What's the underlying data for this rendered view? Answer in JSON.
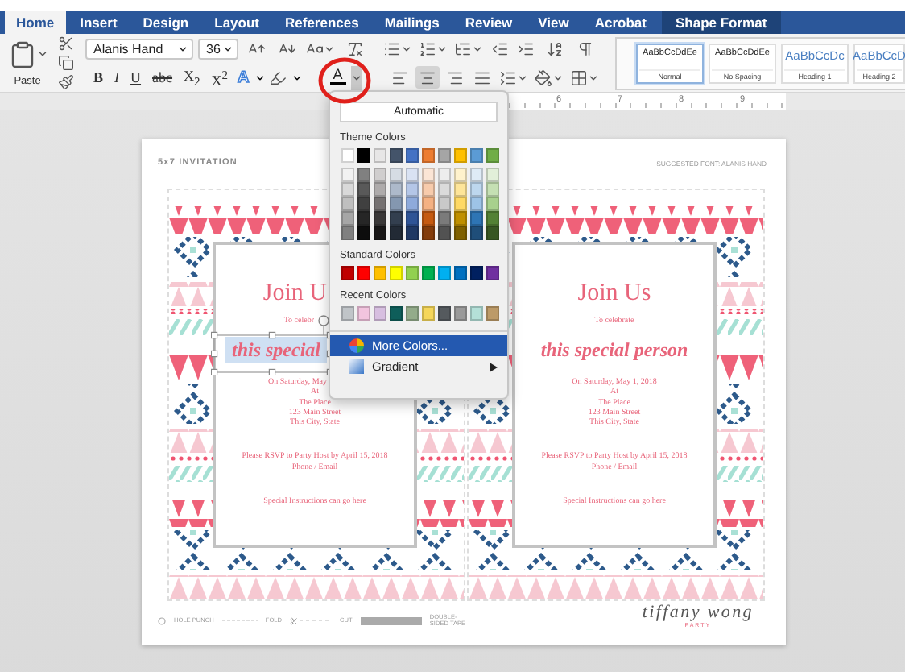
{
  "tabs": [
    {
      "label": "Home",
      "selected": true,
      "contextual": false
    },
    {
      "label": "Insert",
      "selected": false,
      "contextual": false
    },
    {
      "label": "Design",
      "selected": false,
      "contextual": false
    },
    {
      "label": "Layout",
      "selected": false,
      "contextual": false
    },
    {
      "label": "References",
      "selected": false,
      "contextual": false
    },
    {
      "label": "Mailings",
      "selected": false,
      "contextual": false
    },
    {
      "label": "Review",
      "selected": false,
      "contextual": false
    },
    {
      "label": "View",
      "selected": false,
      "contextual": false
    },
    {
      "label": "Acrobat",
      "selected": false,
      "contextual": false
    },
    {
      "label": "Shape Format",
      "selected": false,
      "contextual": true
    }
  ],
  "clipboard": {
    "paste_label": "Paste"
  },
  "font": {
    "name": "Alanis Hand",
    "size": "36"
  },
  "format_buttons": [
    {
      "label": "B",
      "kind": "bold"
    },
    {
      "label": "I",
      "kind": "italic"
    },
    {
      "label": "U",
      "kind": "underline"
    },
    {
      "label": "abc",
      "kind": "strike"
    },
    {
      "label": "X$_{2}$",
      "kind": "plain"
    },
    {
      "label": "X$^{2}$",
      "kind": "plain"
    }
  ],
  "text_effects": {
    "label": "A"
  },
  "font_color": {
    "label": "A",
    "color": "#000000",
    "annotated": true
  },
  "alignment": [
    {
      "kind": "left",
      "selected": false
    },
    {
      "kind": "center",
      "selected": true
    },
    {
      "kind": "right",
      "selected": false
    },
    {
      "kind": "justify",
      "selected": false
    }
  ],
  "styles": [
    {
      "sample": "AaBbCcDdEe",
      "name": "Normal",
      "selected": true,
      "kind": "body"
    },
    {
      "sample": "AaBbCcDdEe",
      "name": "No Spacing",
      "selected": false,
      "kind": "body"
    },
    {
      "sample": "AaBbCcDc",
      "name": "Heading 1",
      "selected": false,
      "kind": "heading"
    },
    {
      "sample": "AaBbCcD",
      "name": "Heading 2",
      "selected": false,
      "kind": "heading"
    }
  ],
  "ruler": {
    "labels": [
      "6",
      "7",
      "8",
      "9"
    ]
  },
  "color_menu": {
    "automatic": "Automatic",
    "theme_title": "Theme Colors",
    "theme": [
      {
        "color": "#ffffff"
      },
      {
        "color": "#000000"
      },
      {
        "color": "#e7e6e6"
      },
      {
        "color": "#44546a"
      },
      {
        "color": "#4472c4"
      },
      {
        "color": "#ed7d31"
      },
      {
        "color": "#a5a5a5"
      },
      {
        "color": "#ffc000"
      },
      {
        "color": "#5b9bd5"
      },
      {
        "color": "#70ad47"
      }
    ],
    "shade_rows": [
      [
        {
          "color": "#f2f2f2"
        },
        {
          "color": "#808080"
        },
        {
          "color": "#d0cece"
        },
        {
          "color": "#d6dce4"
        },
        {
          "color": "#d9e2f3"
        },
        {
          "color": "#fbe5d5"
        },
        {
          "color": "#ededed"
        },
        {
          "color": "#fff2cc"
        },
        {
          "color": "#deebf6"
        },
        {
          "color": "#e2efd9"
        }
      ],
      [
        {
          "color": "#d9d9d9"
        },
        {
          "color": "#595959"
        },
        {
          "color": "#aeabab"
        },
        {
          "color": "#adb9ca"
        },
        {
          "color": "#b4c6e7"
        },
        {
          "color": "#f7cbac"
        },
        {
          "color": "#dbdbdb"
        },
        {
          "color": "#fee599"
        },
        {
          "color": "#bdd7ee"
        },
        {
          "color": "#c5e0b3"
        }
      ],
      [
        {
          "color": "#bfbfbf"
        },
        {
          "color": "#404040"
        },
        {
          "color": "#757171"
        },
        {
          "color": "#8497b0"
        },
        {
          "color": "#8eaadb"
        },
        {
          "color": "#f4b183"
        },
        {
          "color": "#c9c9c9"
        },
        {
          "color": "#ffd965"
        },
        {
          "color": "#9dc3e6"
        },
        {
          "color": "#a8d08d"
        }
      ],
      [
        {
          "color": "#a6a6a6"
        },
        {
          "color": "#262626"
        },
        {
          "color": "#3a3838"
        },
        {
          "color": "#333f4f"
        },
        {
          "color": "#2f5496"
        },
        {
          "color": "#c55a11"
        },
        {
          "color": "#7b7b7b"
        },
        {
          "color": "#bf8f00"
        },
        {
          "color": "#2e75b5"
        },
        {
          "color": "#538135"
        }
      ],
      [
        {
          "color": "#808080"
        },
        {
          "color": "#0d0d0d"
        },
        {
          "color": "#171616"
        },
        {
          "color": "#222a35"
        },
        {
          "color": "#1f3864"
        },
        {
          "color": "#833c0b"
        },
        {
          "color": "#525252"
        },
        {
          "color": "#7f6000"
        },
        {
          "color": "#1f4e79"
        },
        {
          "color": "#375623"
        }
      ]
    ],
    "standard_title": "Standard Colors",
    "standard": [
      {
        "color": "#c00000"
      },
      {
        "color": "#ff0000"
      },
      {
        "color": "#ffc000"
      },
      {
        "color": "#ffff00"
      },
      {
        "color": "#92d050"
      },
      {
        "color": "#00b050"
      },
      {
        "color": "#00b0f0"
      },
      {
        "color": "#0070c0"
      },
      {
        "color": "#002060"
      },
      {
        "color": "#7030a0"
      }
    ],
    "recent_title": "Recent Colors",
    "recent": [
      {
        "color": "#c0c4c8"
      },
      {
        "color": "#f2c4de"
      },
      {
        "color": "#d7bfe0"
      },
      {
        "color": "#0e5e5a"
      },
      {
        "color": "#93ab8a"
      },
      {
        "color": "#f5d65a"
      },
      {
        "color": "#555a5e"
      },
      {
        "color": "#9a9a9a"
      },
      {
        "color": "#b4e0d8"
      },
      {
        "color": "#bc9a68"
      }
    ],
    "items": [
      {
        "label": "More Colors...",
        "kind": "wheel",
        "selected": true,
        "submenu": false
      },
      {
        "label": "Gradient",
        "kind": "gradient",
        "selected": false,
        "submenu": true
      }
    ]
  },
  "document": {
    "title": "5x7 INVITATION",
    "font_note": "SUGGESTED FONT: ALANIS HAND",
    "cards": [
      {
        "groups": [
          {
            "kind": "title",
            "lines": [
              {
                "text": "Join U",
                "cut": true,
                "selected": false
              }
            ]
          },
          {
            "kind": "note",
            "lines": [
              {
                "text": "To celebr",
                "cut": true,
                "selected": false
              }
            ]
          },
          {
            "kind": "script",
            "lines": [
              {
                "text": "this special",
                "cut": true,
                "selected": true
              }
            ]
          },
          {
            "kind": "details",
            "lines": [
              {
                "text": "On Saturday, May",
                "cut": true,
                "selected": false
              },
              {
                "text": "At"
              },
              {
                "text": "The Place"
              },
              {
                "text": "123 Main Street"
              },
              {
                "text": "This City, State"
              }
            ]
          },
          {
            "kind": "rsvp",
            "lines": [
              {
                "text": "Please RSVP to Party Host by April 15, 2018"
              },
              {
                "text": "Phone / Email"
              }
            ]
          },
          {
            "kind": "special",
            "lines": [
              {
                "text": "Special Instructions can go here"
              }
            ]
          }
        ]
      },
      {
        "groups": [
          {
            "kind": "title",
            "lines": [
              {
                "text": "Join Us"
              }
            ]
          },
          {
            "kind": "note",
            "lines": [
              {
                "text": "To celebrate"
              }
            ]
          },
          {
            "kind": "script",
            "lines": [
              {
                "text": "this special person",
                "selected": false
              }
            ]
          },
          {
            "kind": "details",
            "lines": [
              {
                "text": "On Saturday, May 1, 2018"
              },
              {
                "text": "At"
              },
              {
                "text": "The Place"
              },
              {
                "text": "123 Main Street"
              },
              {
                "text": "This City, State"
              }
            ]
          },
          {
            "kind": "rsvp",
            "lines": [
              {
                "text": "Please RSVP to Party Host by April 15, 2018"
              },
              {
                "text": "Phone / Email"
              }
            ]
          },
          {
            "kind": "special",
            "lines": [
              {
                "text": "Special Instructions can go here"
              }
            ]
          }
        ]
      }
    ],
    "legend": [
      {
        "kind": "hole",
        "label": "HOLE PUNCH"
      },
      {
        "kind": "fold",
        "label": "FOLD"
      },
      {
        "kind": "cut",
        "label": "CUT"
      },
      {
        "kind": "tape",
        "label": "DOUBLE-SIDED TAPE"
      }
    ],
    "signature": "tiffany wong",
    "signature_sub": "PARTY"
  }
}
